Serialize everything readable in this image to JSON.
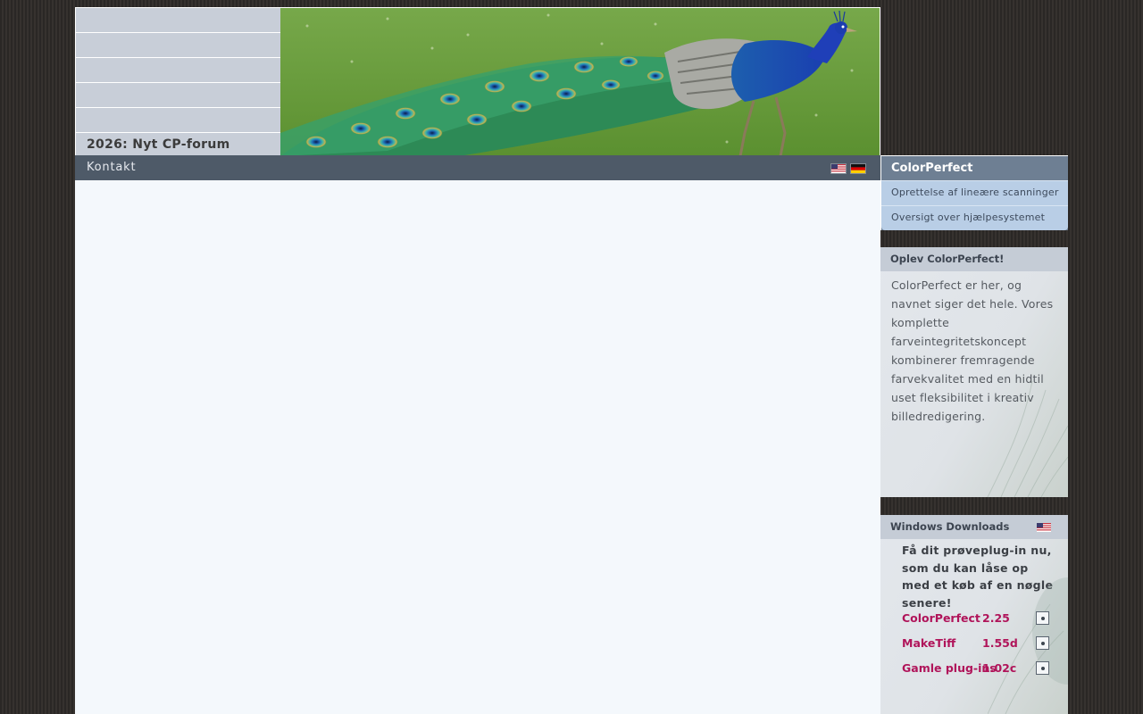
{
  "nav": {
    "items": [
      {
        "label": ""
      },
      {
        "label": ""
      },
      {
        "label": ""
      },
      {
        "label": ""
      },
      {
        "label": ""
      },
      {
        "label": "2026: Nyt CP-forum"
      }
    ]
  },
  "contact": {
    "label": "Kontakt",
    "flags": [
      "us-flag-icon",
      "de-flag-icon"
    ]
  },
  "colorperfect_box": {
    "title": "ColorPerfect",
    "links": [
      "Oprettelse af lineære scanninger",
      "Oversigt over hjælpesystemet"
    ]
  },
  "oplev": {
    "title": "Oplev ColorPerfect!",
    "body": "ColorPerfect er her, og navnet siger det hele. Vores komplette farveintegritetskoncept kombinerer fremragende farvekvalitet med en hidtil uset fleksibilitet i kreativ billedredigering."
  },
  "downloads": {
    "title": "Windows Downloads",
    "intro": "Få dit prøveplug-in nu, som du kan låse op med et køb af en nøgle senere!",
    "items": [
      {
        "name": "ColorPerfect",
        "version": "2.25"
      },
      {
        "name": "MakeTiff",
        "version": "1.55d"
      },
      {
        "name": "Gamle plug-ins",
        "version": "1.02c"
      }
    ]
  },
  "colors": {
    "nav_bg": "#c8ced8",
    "bar_bg": "#4e5a68",
    "link_accent": "#b0145a",
    "main_bg": "#f4f8fc"
  }
}
